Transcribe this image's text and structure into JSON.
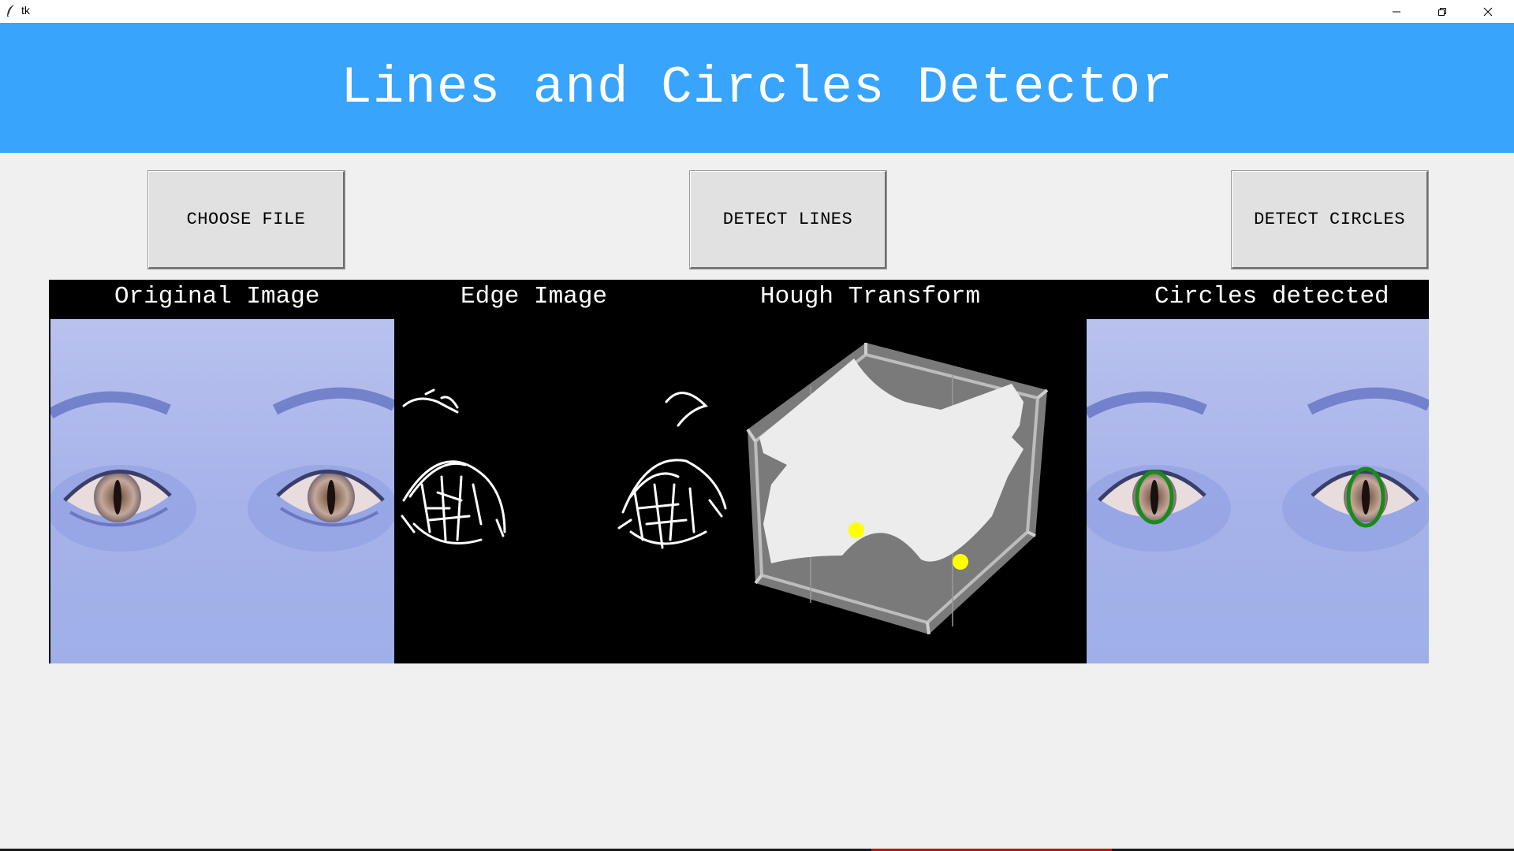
{
  "window": {
    "title": "tk",
    "app_icon": "feather-icon",
    "controls": [
      "minimize-icon",
      "maximize-icon",
      "close-icon"
    ]
  },
  "header": {
    "title": "Lines and Circles Detector",
    "background": "#38a4fc"
  },
  "buttons": {
    "choose_file": "CHOOSE FILE",
    "detect_lines": "DETECT LINES",
    "detect_circles": "DETECT CIRCLES"
  },
  "panels": {
    "original": "Original Image",
    "edge": "Edge Image",
    "hough": "Hough Transform",
    "circles": "Circles detected"
  },
  "colors": {
    "skin": "#a9b6ec",
    "hough_peak": "#ffff00",
    "circle_outline": "#1a8a1a"
  }
}
